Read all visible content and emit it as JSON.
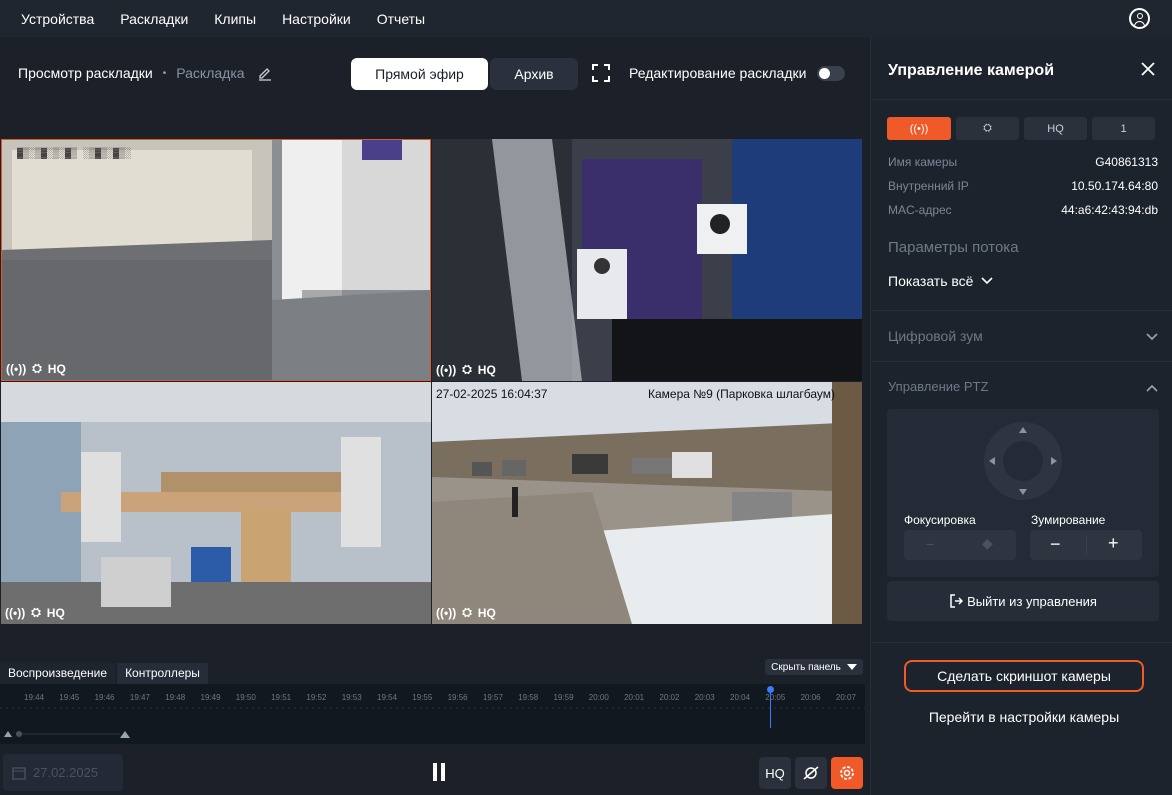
{
  "nav": {
    "items": [
      "Устройства",
      "Раскладки",
      "Клипы",
      "Настройки",
      "Отчеты"
    ]
  },
  "header": {
    "title": "Просмотр раскладки",
    "separator": "•",
    "layout_name": "Раскладка",
    "live_label": "Прямой эфир",
    "archive_label": "Архив",
    "edit_layout_label": "Редактирование раскладки",
    "edit_layout_enabled": false
  },
  "cameras": [
    {
      "osd": "▓▒░▒▓░▒░▓▒ ░▒▓▒░▓▒░",
      "footer_hq": "HQ",
      "selected": true
    },
    {
      "osd": "",
      "footer_hq": "HQ",
      "selected": false
    },
    {
      "osd": "",
      "footer_hq": "HQ",
      "selected": false
    },
    {
      "osd_time": "27-02-2025 16:04:37",
      "osd_name": "Камера №9 (Парковка шлагбаум)",
      "footer_hq": "HQ",
      "selected": false
    }
  ],
  "playback": {
    "tab_playback": "Воспроизведение",
    "tab_controllers": "Контроллеры",
    "hide_panel": "Скрыть панель",
    "ticks": [
      "19:44",
      "19:45",
      "19:46",
      "19:47",
      "19:48",
      "19:49",
      "19:50",
      "19:51",
      "19:52",
      "19:53",
      "19:54",
      "19:55",
      "19:56",
      "19:57",
      "19:58",
      "19:59",
      "20:00",
      "20:01",
      "20:02",
      "20:03",
      "20:04",
      "20:05",
      "20:06",
      "20:07"
    ],
    "date": "27.02.2025",
    "hq_label": "HQ"
  },
  "panel": {
    "title": "Управление камерой",
    "seg_hq": "HQ",
    "seg_num": "1",
    "camera_name_label": "Имя камеры",
    "camera_name": "G40861313",
    "ip_label": "Внутренний IP",
    "ip": "10.50.174.64:80",
    "mac_label": "MAC-адрес",
    "mac": "44:a6:42:43:94:db",
    "stream_params": "Параметры потока",
    "show_all": "Показать всё",
    "digital_zoom": "Цифровой зум",
    "ptz": "Управление PTZ",
    "focus_label": "Фокусировка",
    "zoom_label": "Зумирование",
    "exit_control": "Выйти из управления",
    "screenshot": "Сделать скриншот камеры",
    "go_settings": "Перейти в настройки камеры"
  },
  "colors": {
    "accent": "#f05a28",
    "timeline_cursor": "#3b79ff"
  }
}
